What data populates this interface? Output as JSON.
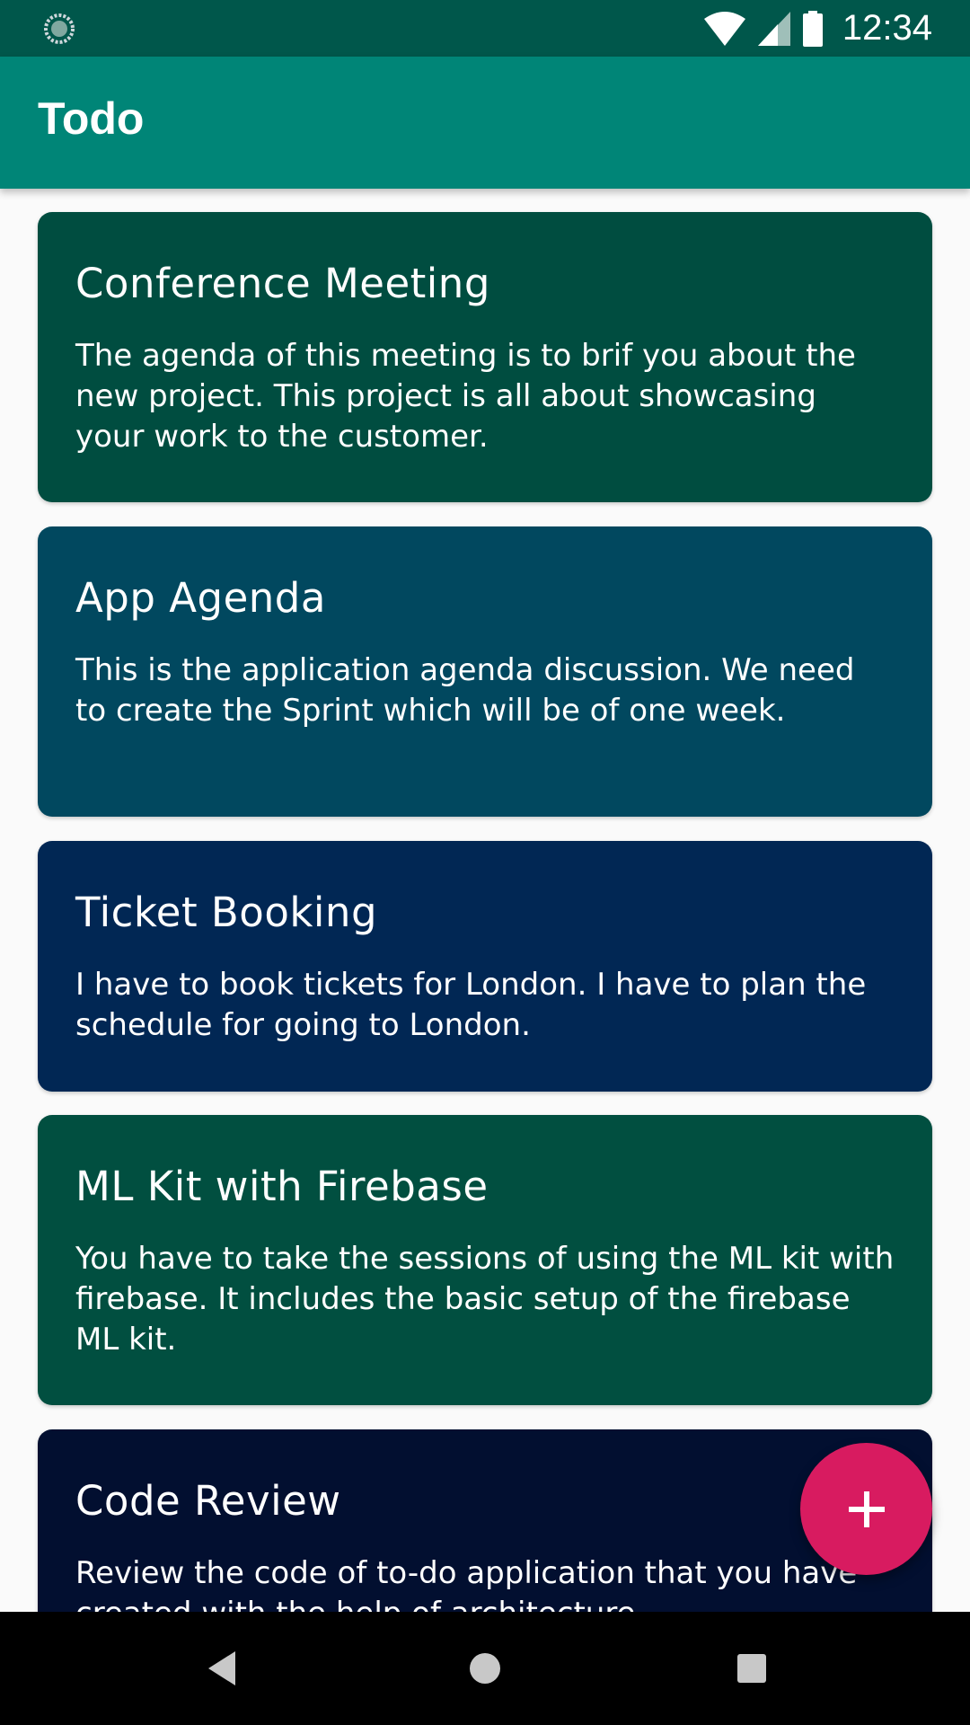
{
  "status_bar": {
    "time": "12:34",
    "icons": [
      "sync-icon",
      "wifi-icon",
      "signal-icon",
      "battery-icon"
    ],
    "background": "#00574b"
  },
  "app_bar": {
    "title": "Todo",
    "background": "#008577"
  },
  "todos": [
    {
      "title": "Conference Meeting",
      "description": "The agenda of this meeting is to brif you about the new project. This project is all about showcasing your work to the customer.",
      "color": "#004d40"
    },
    {
      "title": "App Agenda",
      "description": "This is the application agenda discussion. We need to create the Sprint which will be of one week.",
      "color": "#01485f"
    },
    {
      "title": "Ticket Booking",
      "description": "I have to book tickets for London. I have to plan the schedule for going to London.",
      "color": "#012754"
    },
    {
      "title": "ML Kit with Firebase",
      "description": "You have to take the sessions of using the ML kit with firebase. It includes the basic setup of the firebase ML kit.",
      "color": "#014f40"
    },
    {
      "title": "Code Review",
      "description": "Review the code of to-do application that you have created with the help of architecture",
      "color": "#020f30"
    }
  ],
  "fab": {
    "icon": "plus-icon",
    "color": "#d81b60"
  },
  "nav_bar": {
    "icons": [
      "back-icon",
      "home-icon",
      "recents-icon"
    ]
  }
}
